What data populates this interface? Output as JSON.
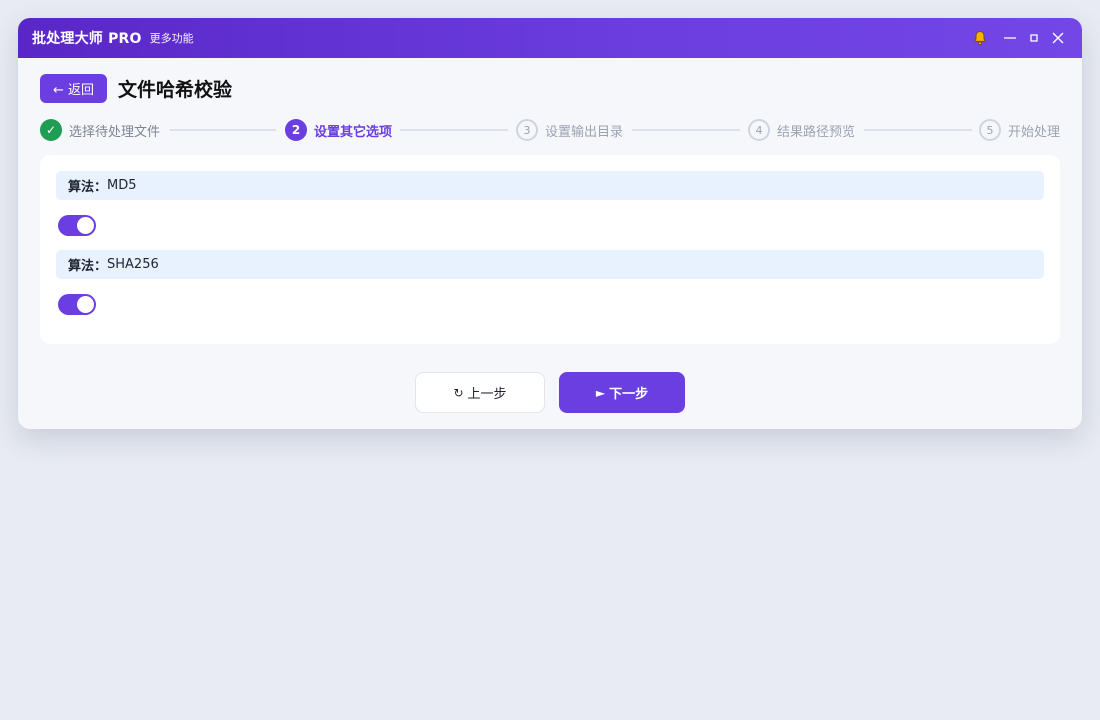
{
  "titlebar": {
    "app_title": "批处理大师 PRO",
    "more_features": "更多功能",
    "icons": [
      "bell-icon",
      "minimize-icon",
      "maximize-icon",
      "close-icon"
    ]
  },
  "header": {
    "back_label": "← 返回",
    "page_title": "文件哈希校验"
  },
  "stepper": {
    "steps": [
      {
        "index": "✓",
        "label": "选择待处理文件",
        "state": "done"
      },
      {
        "index": "2",
        "label": "设置其它选项",
        "state": "active"
      },
      {
        "index": "3",
        "label": "设置输出目录",
        "state": "pending"
      },
      {
        "index": "4",
        "label": "结果路径预览",
        "state": "pending"
      },
      {
        "index": "5",
        "label": "开始处理",
        "state": "pending"
      }
    ]
  },
  "options": [
    {
      "key_label": "算法：",
      "value": "MD5",
      "enabled": true
    },
    {
      "key_label": "算法：",
      "value": "SHA256",
      "enabled": true
    }
  ],
  "footer": {
    "prev_label": "上一步",
    "prev_icon": "↻",
    "next_label": "下一步",
    "next_icon": "►"
  },
  "colors": {
    "accent": "#6a3ee0",
    "done": "#1f9d55",
    "bell": "#f5b301",
    "algo_bar_bg": "#e8f1fe"
  }
}
